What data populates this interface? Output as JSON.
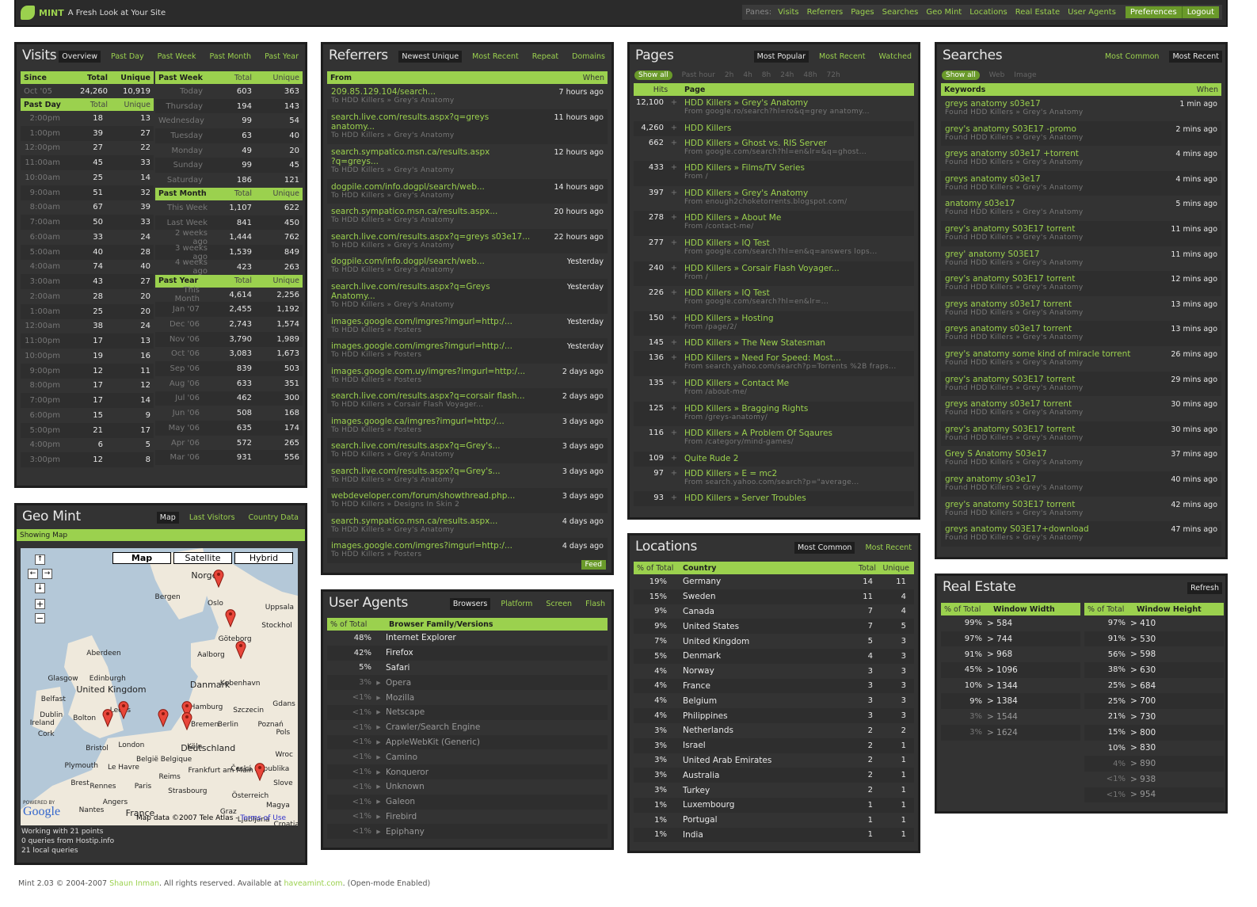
{
  "header": {
    "app": "MINT",
    "tagline": "A Fresh Look at Your Site",
    "panes_label": "Panes:",
    "panes": [
      "Visits",
      "Referrers",
      "Pages",
      "Searches",
      "Geo Mint",
      "Locations",
      "Real Estate",
      "User Agents"
    ],
    "preferences": "Preferences",
    "logout": "Logout"
  },
  "visits": {
    "title": "Visits",
    "tabs": [
      "Overview",
      "Past Day",
      "Past Week",
      "Past Month",
      "Past Year"
    ],
    "since": {
      "h": [
        "Since",
        "Total",
        "Unique"
      ],
      "row": [
        "Oct '05",
        "24,260",
        "10,919"
      ]
    },
    "past_day": {
      "h": [
        "Past Day",
        "Total",
        "Unique"
      ],
      "rows": [
        [
          "2:00pm",
          "18",
          "13"
        ],
        [
          "1:00pm",
          "39",
          "27"
        ],
        [
          "12:00pm",
          "27",
          "22"
        ],
        [
          "11:00am",
          "45",
          "33"
        ],
        [
          "10:00am",
          "25",
          "14"
        ],
        [
          "9:00am",
          "51",
          "32"
        ],
        [
          "8:00am",
          "67",
          "39"
        ],
        [
          "7:00am",
          "50",
          "33"
        ],
        [
          "6:00am",
          "33",
          "24"
        ],
        [
          "5:00am",
          "40",
          "28"
        ],
        [
          "4:00am",
          "74",
          "40"
        ],
        [
          "3:00am",
          "43",
          "27"
        ],
        [
          "2:00am",
          "28",
          "20"
        ],
        [
          "1:00am",
          "25",
          "20"
        ],
        [
          "12:00am",
          "38",
          "24"
        ],
        [
          "11:00pm",
          "17",
          "13"
        ],
        [
          "10:00pm",
          "19",
          "16"
        ],
        [
          "9:00pm",
          "12",
          "11"
        ],
        [
          "8:00pm",
          "17",
          "12"
        ],
        [
          "7:00pm",
          "17",
          "14"
        ],
        [
          "6:00pm",
          "15",
          "9"
        ],
        [
          "5:00pm",
          "21",
          "17"
        ],
        [
          "4:00pm",
          "6",
          "5"
        ],
        [
          "3:00pm",
          "12",
          "8"
        ]
      ]
    },
    "past_week": {
      "h": [
        "Past Week",
        "Total",
        "Unique"
      ],
      "rows": [
        [
          "Today",
          "603",
          "363"
        ],
        [
          "Thursday",
          "194",
          "143"
        ],
        [
          "Wednesday",
          "99",
          "54"
        ],
        [
          "Tuesday",
          "63",
          "40"
        ],
        [
          "Monday",
          "49",
          "20"
        ],
        [
          "Sunday",
          "99",
          "45"
        ],
        [
          "Saturday",
          "186",
          "121"
        ]
      ]
    },
    "past_month": {
      "h": [
        "Past Month",
        "Total",
        "Unique"
      ],
      "rows": [
        [
          "This Week",
          "1,107",
          "622"
        ],
        [
          "Last Week",
          "841",
          "450"
        ],
        [
          "2 weeks ago",
          "1,444",
          "762"
        ],
        [
          "3 weeks ago",
          "1,539",
          "849"
        ],
        [
          "4 weeks ago",
          "423",
          "263"
        ]
      ]
    },
    "past_year": {
      "h": [
        "Past Year",
        "Total",
        "Unique"
      ],
      "rows": [
        [
          "This Month",
          "4,614",
          "2,256"
        ],
        [
          "Jan '07",
          "2,455",
          "1,192"
        ],
        [
          "Dec '06",
          "2,743",
          "1,574"
        ],
        [
          "Nov '06",
          "3,790",
          "1,989"
        ],
        [
          "Oct '06",
          "3,083",
          "1,673"
        ],
        [
          "Sep '06",
          "839",
          "503"
        ],
        [
          "Aug '06",
          "633",
          "351"
        ],
        [
          "Jul '06",
          "462",
          "300"
        ],
        [
          "Jun '06",
          "508",
          "168"
        ],
        [
          "May '06",
          "635",
          "174"
        ],
        [
          "Apr '06",
          "572",
          "265"
        ],
        [
          "Mar '06",
          "931",
          "556"
        ]
      ]
    }
  },
  "referrers": {
    "title": "Referrers",
    "tabs": [
      "Newest Unique",
      "Most Recent",
      "Repeat",
      "Domains"
    ],
    "h": [
      "From",
      "When"
    ],
    "feed": "Feed",
    "rows": [
      [
        "209.85.129.104/search...",
        "",
        "To HDD Killers » Grey's Anatomy",
        "7 hours ago"
      ],
      [
        "search.live.com/results.aspx?q=greys",
        "anatomy...",
        "To HDD Killers » Grey's Anatomy",
        "11 hours ago"
      ],
      [
        "search.sympatico.msn.ca/results.aspx",
        "?q=greys...",
        "To HDD Killers » Grey's Anatomy",
        "12 hours ago"
      ],
      [
        "dogpile.com/info.dogpl/search/web...",
        "",
        "To HDD Killers » Grey's Anatomy",
        "14 hours ago"
      ],
      [
        "search.sympatico.msn.ca/results.aspx...",
        "",
        "To HDD Killers » Grey's Anatomy",
        "20 hours ago"
      ],
      [
        "search.live.com/results.aspx?q=greys s03e17...",
        "",
        "To HDD Killers » Grey's Anatomy",
        "22 hours ago"
      ],
      [
        "dogpile.com/info.dogpl/search/web...",
        "",
        "To HDD Killers » Grey's Anatomy",
        "Yesterday"
      ],
      [
        "search.live.com/results.aspx?q=Greys",
        "Anatomy...",
        "To HDD Killers » Grey's Anatomy",
        "Yesterday"
      ],
      [
        "images.google.com/imgres?imgurl=http:/...",
        "",
        "To HDD Killers » Posters",
        "Yesterday"
      ],
      [
        "images.google.com/imgres?imgurl=http:/...",
        "",
        "To HDD Killers » Posters",
        "Yesterday"
      ],
      [
        "images.google.com.uy/imgres?imgurl=http:/...",
        "",
        "To HDD Killers » Posters",
        "2 days ago"
      ],
      [
        "search.live.com/results.aspx?q=corsair flash...",
        "",
        "To HDD Killers » Corsair Flash Voyager...",
        "2 days ago"
      ],
      [
        "images.google.ca/imgres?imgurl=http:/...",
        "",
        "To HDD Killers » Posters",
        "3 days ago"
      ],
      [
        "search.live.com/results.aspx?q=Grey's...",
        "",
        "To HDD Killers » Grey's Anatomy",
        "3 days ago"
      ],
      [
        "search.live.com/results.aspx?q=Grey's...",
        "",
        "To HDD Killers » Grey's Anatomy",
        "3 days ago"
      ],
      [
        "webdeveloper.com/forum/showthread.php...",
        "",
        "To HDD Killers » Designs In Skin 2",
        "3 days ago"
      ],
      [
        "search.sympatico.msn.ca/results.aspx...",
        "",
        "To HDD Killers » Grey's Anatomy",
        "4 days ago"
      ],
      [
        "images.google.com/imgres?imgurl=http:/...",
        "",
        "To HDD Killers » Posters",
        "4 days ago"
      ]
    ]
  },
  "pages": {
    "title": "Pages",
    "tabs": [
      "Most Popular",
      "Most Recent",
      "Watched"
    ],
    "filters": [
      "Show all",
      "Past hour",
      "2h",
      "4h",
      "8h",
      "24h",
      "48h",
      "72h"
    ],
    "h": [
      "Hits",
      "Page"
    ],
    "rows": [
      [
        "12,100",
        "HDD Killers » Grey's Anatomy",
        "From google.ro/search?hl=ro&q=grey anatomy..."
      ],
      [
        "4,260",
        "HDD Killers",
        ""
      ],
      [
        "662",
        "HDD Killers » Ghost vs. RIS Server",
        "From google.com/search?hl=en&lr=&q=ghost..."
      ],
      [
        "433",
        "HDD Killers » Films/TV Series",
        "From /"
      ],
      [
        "397",
        "HDD Killers » Grey's Anatomy",
        "From enough2choketorrents.blogspot.com/"
      ],
      [
        "278",
        "HDD Killers » About Me",
        "From /contact-me/"
      ],
      [
        "277",
        "HDD Killers » IQ Test",
        "From google.com/search?hl=en&q=answers lops..."
      ],
      [
        "240",
        "HDD Killers » Corsair Flash Voyager...",
        "From /"
      ],
      [
        "226",
        "HDD Killers » IQ Test",
        "From google.com/search?hl=en&lr=..."
      ],
      [
        "150",
        "HDD Killers » Hosting",
        "From /page/2/"
      ],
      [
        "145",
        "HDD Killers » The New Statesman",
        ""
      ],
      [
        "136",
        "HDD Killers » Need For Speed: Most...",
        "From search.yahoo.com/search?p=Torrents %2B fraps..."
      ],
      [
        "135",
        "HDD Killers » Contact Me",
        "From /about-me/"
      ],
      [
        "125",
        "HDD Killers » Bragging Rights",
        "From /greys-anatomy/"
      ],
      [
        "116",
        "HDD Killers » A Problem Of Sqaures",
        "From /category/mind-games/"
      ],
      [
        "109",
        "Quite Rude 2",
        ""
      ],
      [
        "97",
        "HDD Killers » E = mc2",
        "From search.yahoo.com/search?p=\"average..."
      ],
      [
        "93",
        "HDD Killers » Server Troubles",
        ""
      ]
    ]
  },
  "searches": {
    "title": "Searches",
    "tabs": [
      "Most Common",
      "Most Recent"
    ],
    "filters": [
      "Show all",
      "Web",
      "Image"
    ],
    "h": [
      "Keywords",
      "When"
    ],
    "found": "Found HDD Killers » Grey's Anatomy",
    "rows": [
      [
        "greys anatomy s03e17",
        "1 min ago"
      ],
      [
        "grey's anatomy S03E17 -promo",
        "2 mins ago"
      ],
      [
        "greys anatomy s03e17 +torrent",
        "4 mins ago"
      ],
      [
        "greys anatomy s03e17",
        "4 mins ago"
      ],
      [
        "anatomy s03e17",
        "5 mins ago"
      ],
      [
        "grey's anatomy S03E17 torrent",
        "11 mins ago"
      ],
      [
        "grey' anatomy S03E17",
        "11 mins ago"
      ],
      [
        "grey's anatomy S03E17 torrent",
        "12 mins ago"
      ],
      [
        "greys anatomy s03e17 torrent",
        "13 mins ago"
      ],
      [
        "greys anatomy s03e17 torrent",
        "13 mins ago"
      ],
      [
        "grey's anatomy some kind of miracle torrent",
        "26 mins ago"
      ],
      [
        "grey's anatomy S03E17 torrent",
        "29 mins ago"
      ],
      [
        "greys anatomy s03e17 torrent",
        "30 mins ago"
      ],
      [
        "grey's anatomy S03E17 torrent",
        "30 mins ago"
      ],
      [
        "Grey S Anatomy S03e17",
        "37 mins ago"
      ],
      [
        "grey anatomy s03e17",
        "40 mins ago"
      ],
      [
        "grey's anatomy S03E17 torrent",
        "42 mins ago"
      ],
      [
        "greys anatomy S03E17+download",
        "47 mins ago"
      ]
    ]
  },
  "geo": {
    "title": "Geo Mint",
    "tabs": [
      "Map",
      "Last Visitors",
      "Country Data"
    ],
    "showing": "Showing Map",
    "map_buttons": [
      "Map",
      "Satellite",
      "Hybrid"
    ],
    "labels": [
      "Norge",
      "Bergen",
      "Oslo",
      "Uppsala",
      "Stockhol",
      "Göteborg",
      "Aberdeen",
      "Aalborg",
      "Glasgow",
      "Edinburgh",
      "United Kingdom",
      "Danmark",
      "København",
      "Belfast",
      "Leeds",
      "Hamburg",
      "Szczecin",
      "Gdans",
      "Dublin",
      "Ireland",
      "Bolton",
      "Bremen",
      "Berlin",
      "Poznań",
      "Cork",
      "Bristol",
      "London",
      "Deutschland",
      "Pols",
      "Plymouth",
      "Le Havre",
      "België Belgique",
      "Köln",
      "Frankfurt am Main",
      "Česká Republika",
      "Wroc",
      "Brest",
      "Rennes",
      "Paris",
      "Reims",
      "Strasbourg",
      "Österreich",
      "Slove",
      "Nantes",
      "Angers",
      "France",
      "Graz",
      "Magya",
      "Ljubljana",
      "Croatia"
    ],
    "powered": "POWERED BY",
    "google": "Google",
    "mapdata": "Map data ©2007 Tele Atlas -",
    "terms": "Terms of Use",
    "stats": [
      "Working with 21 points",
      "0 queries from Hostip.info",
      "21 local queries"
    ]
  },
  "user_agents": {
    "title": "User Agents",
    "tabs": [
      "Browsers",
      "Platform",
      "Screen",
      "Flash"
    ],
    "h": [
      "% of Total",
      "Browser Family/Versions"
    ],
    "rows": [
      [
        "48%",
        "Internet Explorer"
      ],
      [
        "42%",
        "Firefox"
      ],
      [
        "5%",
        "Safari"
      ],
      [
        "3%",
        "Opera"
      ],
      [
        "<1%",
        "Mozilla"
      ],
      [
        "<1%",
        "Netscape"
      ],
      [
        "<1%",
        "Crawler/Search Engine"
      ],
      [
        "<1%",
        "AppleWebKit (Generic)"
      ],
      [
        "<1%",
        "Camino"
      ],
      [
        "<1%",
        "Konqueror"
      ],
      [
        "<1%",
        "Unknown"
      ],
      [
        "<1%",
        "Galeon"
      ],
      [
        "<1%",
        "Firebird"
      ],
      [
        "<1%",
        "Epiphany"
      ]
    ]
  },
  "locations": {
    "title": "Locations",
    "tabs": [
      "Most Common",
      "Most Recent"
    ],
    "h": [
      "% of Total",
      "Country",
      "Total",
      "Unique"
    ],
    "rows": [
      [
        "19%",
        "Germany",
        "14",
        "11"
      ],
      [
        "15%",
        "Sweden",
        "11",
        "4"
      ],
      [
        "9%",
        "Canada",
        "7",
        "4"
      ],
      [
        "9%",
        "United States",
        "7",
        "5"
      ],
      [
        "7%",
        "United Kingdom",
        "5",
        "3"
      ],
      [
        "5%",
        "Denmark",
        "4",
        "3"
      ],
      [
        "4%",
        "Norway",
        "3",
        "3"
      ],
      [
        "4%",
        "France",
        "3",
        "3"
      ],
      [
        "4%",
        "Belgium",
        "3",
        "3"
      ],
      [
        "4%",
        "Philippines",
        "3",
        "3"
      ],
      [
        "3%",
        "Netherlands",
        "2",
        "2"
      ],
      [
        "3%",
        "Israel",
        "2",
        "1"
      ],
      [
        "3%",
        "United Arab Emirates",
        "2",
        "1"
      ],
      [
        "3%",
        "Australia",
        "2",
        "1"
      ],
      [
        "3%",
        "Turkey",
        "2",
        "1"
      ],
      [
        "1%",
        "Luxembourg",
        "1",
        "1"
      ],
      [
        "1%",
        "Portugal",
        "1",
        "1"
      ],
      [
        "1%",
        "India",
        "1",
        "1"
      ]
    ]
  },
  "real_estate": {
    "title": "Real Estate",
    "refresh": "Refresh",
    "hw": [
      "% of Total",
      "Window Width"
    ],
    "hh": [
      "% of Total",
      "Window Height"
    ],
    "width": [
      [
        "99%",
        "> 584"
      ],
      [
        "97%",
        "> 744"
      ],
      [
        "91%",
        "> 968"
      ],
      [
        "45%",
        "> 1096"
      ],
      [
        "10%",
        "> 1344"
      ],
      [
        "9%",
        "> 1384"
      ],
      [
        "3%",
        "> 1544"
      ],
      [
        "3%",
        "> 1624"
      ]
    ],
    "height": [
      [
        "97%",
        "> 410"
      ],
      [
        "91%",
        "> 530"
      ],
      [
        "56%",
        "> 598"
      ],
      [
        "38%",
        "> 630"
      ],
      [
        "25%",
        "> 684"
      ],
      [
        "25%",
        "> 700"
      ],
      [
        "21%",
        "> 730"
      ],
      [
        "15%",
        "> 800"
      ],
      [
        "10%",
        "> 830"
      ],
      [
        "4%",
        "> 890"
      ],
      [
        "<1%",
        "> 938"
      ],
      [
        "<1%",
        "> 954"
      ]
    ]
  },
  "footer": {
    "pre": "Mint 2.03 © 2004-2007",
    "author": "Shaun Inman",
    "mid": ". All rights reserved. Available at",
    "site": "haveamint.com",
    "post": ". (Open-mode Enabled)"
  },
  "colors": {
    "accent": "#9bd14e",
    "panel": "#333333",
    "border": "#1e1e1e"
  }
}
